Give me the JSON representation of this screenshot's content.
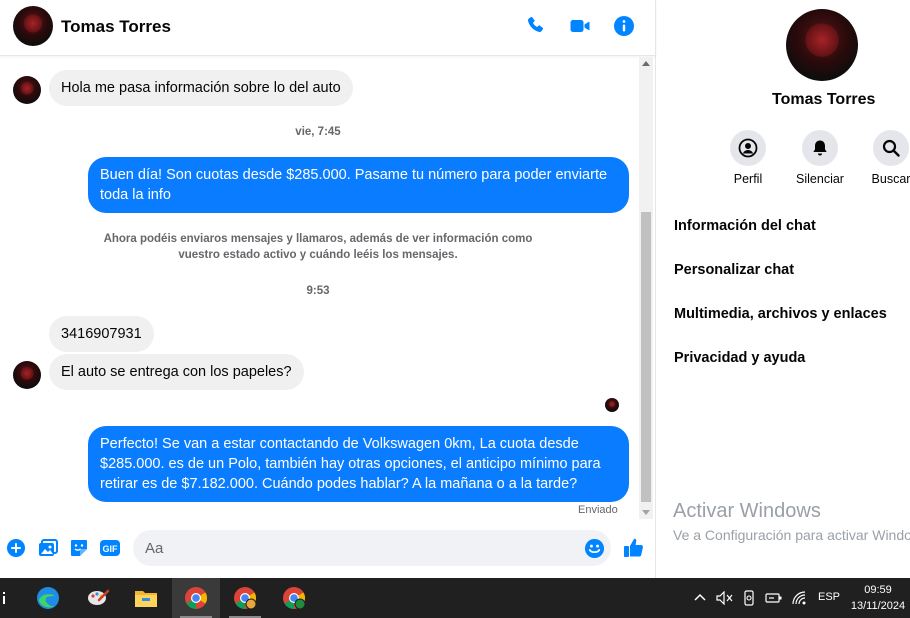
{
  "colors": {
    "brand_blue": "#0a7cff",
    "icon_blue": "#0084ff",
    "incoming_bubble": "#f0f0f0",
    "muted_text": "#65676b",
    "taskbar": "#202020"
  },
  "header": {
    "name": "Tomas Torres",
    "icons": [
      "phone-icon",
      "video-camera-icon",
      "info-icon"
    ]
  },
  "messages": {
    "m1": "Hola me pasa información sobre lo del auto",
    "ts1": "vie, 7:45",
    "m2": "Buen día! Son cuotas desde $285.000. Pasame tu número para poder enviarte toda la info",
    "note": "Ahora podéis enviaros mensajes y llamaros, además de ver información como vuestro estado activo y cuándo leéis los mensajes.",
    "ts2": "9:53",
    "m3": "3416907931",
    "m4": "El auto se entrega con los papeles?",
    "m5": "Perfecto!  Se van a estar contactando de Volkswagen 0km, La cuota desde $285.000. es de un Polo, también hay otras opciones, el anticipo mínimo para retirar es de $7.182.000. Cuándo podes hablar? A la mañana o a la tarde?",
    "status": "Enviado"
  },
  "composer": {
    "placeholder": "Aa",
    "icons": [
      "plus-icon",
      "photo-icon",
      "sticker-icon",
      "gif-icon",
      "emoji-icon",
      "thumbs-up-icon"
    ]
  },
  "panel": {
    "name": "Tomas Torres",
    "actions": [
      {
        "label": "Perfil",
        "icon": "profile-icon"
      },
      {
        "label": "Silenciar",
        "icon": "bell-icon"
      },
      {
        "label": "Buscar",
        "icon": "search-icon"
      }
    ],
    "items": [
      "Información del chat",
      "Personalizar chat",
      "Multimedia, archivos y enlaces",
      "Privacidad y ayuda"
    ],
    "watermark_title": "Activar Windows",
    "watermark_sub": "Ve a Configuración para activar Windows."
  },
  "taskbar": {
    "apps": [
      "edge-icon",
      "paint-icon",
      "file-explorer-icon",
      "chrome-icon",
      "chrome-profile-icon",
      "chrome-profile-t-icon"
    ],
    "language": "ESP",
    "time": "09:59",
    "date": "13/11/2024"
  }
}
